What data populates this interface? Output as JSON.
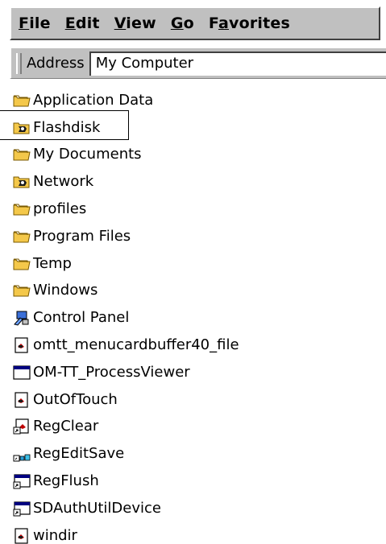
{
  "menu": {
    "file": {
      "accel": "F",
      "rest": "ile"
    },
    "edit": {
      "accel": "E",
      "rest": "dit"
    },
    "view": {
      "accel": "V",
      "rest": "iew"
    },
    "go": {
      "accel": "G",
      "rest": "o"
    },
    "favorites": {
      "pre": "F",
      "accel": "a",
      "rest": "vorites"
    }
  },
  "address": {
    "label": "Address",
    "value": "My Computer"
  },
  "files": [
    {
      "name": "Application Data",
      "icon": "folder-icon"
    },
    {
      "name": "Flashdisk",
      "icon": "storage-folder-icon"
    },
    {
      "name": "My Documents",
      "icon": "folder-icon"
    },
    {
      "name": "Network",
      "icon": "storage-folder-icon"
    },
    {
      "name": "profiles",
      "icon": "folder-icon"
    },
    {
      "name": "Program Files",
      "icon": "folder-icon"
    },
    {
      "name": "Temp",
      "icon": "folder-icon"
    },
    {
      "name": "Windows",
      "icon": "folder-icon"
    },
    {
      "name": "Control Panel",
      "icon": "control-panel-icon"
    },
    {
      "name": "omtt_menucardbuffer40_file",
      "icon": "file-icon"
    },
    {
      "name": "OM-TT_ProcessViewer",
      "icon": "application-window-icon"
    },
    {
      "name": "OutOfTouch",
      "icon": "file-icon"
    },
    {
      "name": "RegClear",
      "icon": "shortcut-icon"
    },
    {
      "name": "RegEditSave",
      "icon": "registry-shortcut-icon"
    },
    {
      "name": "RegFlush",
      "icon": "window-shortcut-icon"
    },
    {
      "name": "SDAuthUtilDevice",
      "icon": "window-shortcut-icon"
    },
    {
      "name": "windir",
      "icon": "file-icon"
    }
  ],
  "colors": {
    "chrome": "#c0c0c0",
    "folder": "#f4c84a",
    "title_blue": "#000080"
  }
}
